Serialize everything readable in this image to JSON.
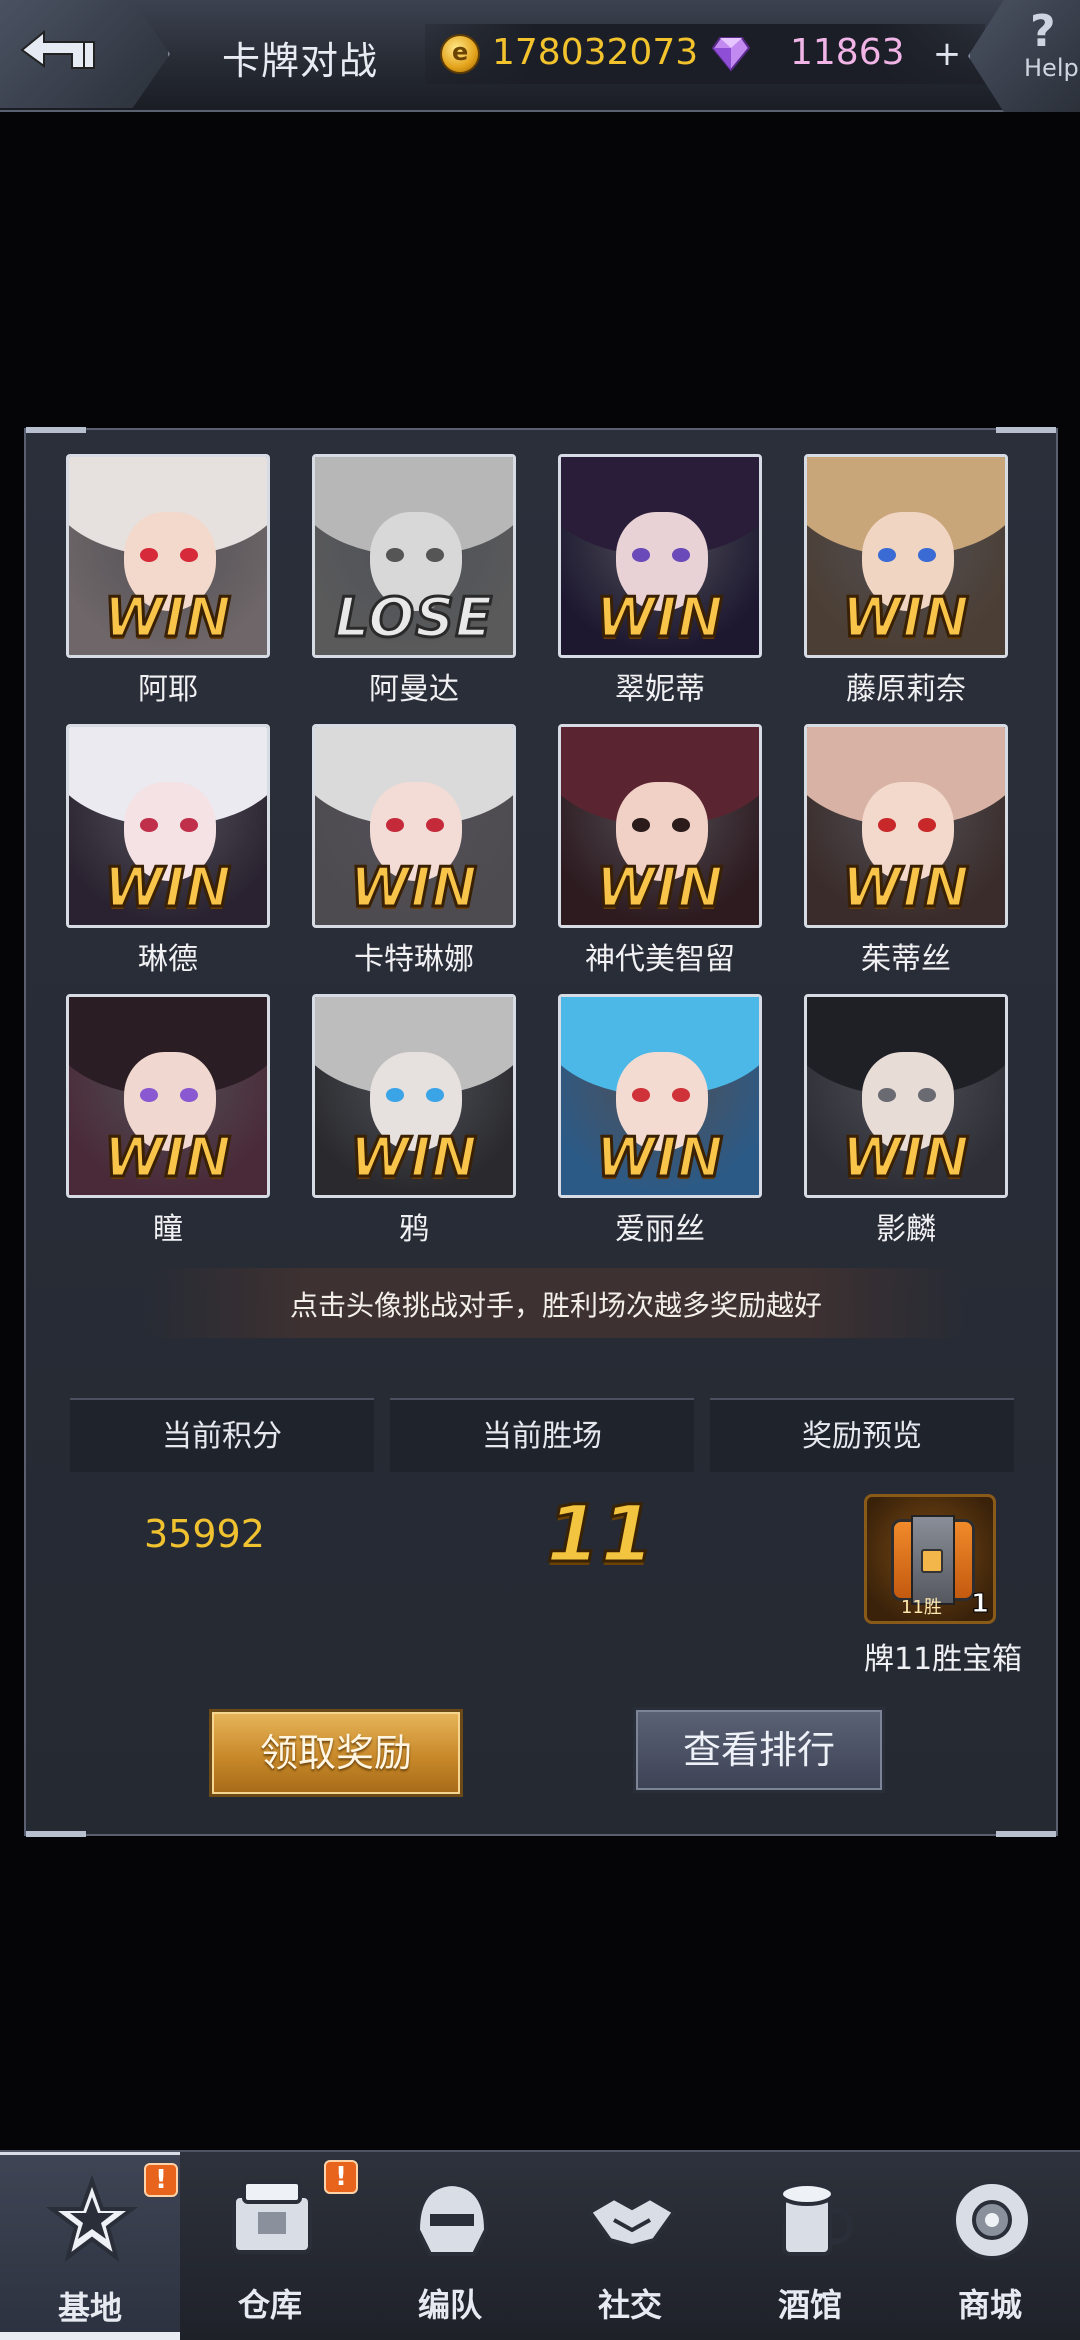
{
  "header": {
    "title": "卡牌对战",
    "gold": "178032073",
    "gems": "11863",
    "plus_label": "+",
    "help_label": "Help",
    "help_glyph": "?"
  },
  "opponents": [
    {
      "name": "阿耶",
      "result": "WIN",
      "hair": "#e6e1de",
      "skin": "#f3d9cc",
      "eye": "#d62a3a",
      "bg": "#6e6668"
    },
    {
      "name": "阿曼达",
      "result": "LOSE",
      "hair": "#b7b7b7",
      "skin": "#d8d8d8",
      "eye": "#555555",
      "bg": "#5a5a5a"
    },
    {
      "name": "翠妮蒂",
      "result": "WIN",
      "hair": "#2a1d3a",
      "skin": "#e8d2d6",
      "eye": "#6a4ab8",
      "bg": "#1d1830"
    },
    {
      "name": "藤原莉奈",
      "result": "WIN",
      "hair": "#c9a57a",
      "skin": "#f1d5c3",
      "eye": "#3a6bd4",
      "bg": "#4b3e34"
    },
    {
      "name": "琳德",
      "result": "WIN",
      "hair": "#eaeaf0",
      "skin": "#f5e2e4",
      "eye": "#c0304a",
      "bg": "#2a2230"
    },
    {
      "name": "卡特琳娜",
      "result": "WIN",
      "hair": "#dadada",
      "skin": "#f3dcd6",
      "eye": "#c52a3a",
      "bg": "#4e4b50"
    },
    {
      "name": "神代美智留",
      "result": "WIN",
      "hair": "#5a2430",
      "skin": "#f1d0c5",
      "eye": "#2b1b1b",
      "bg": "#2d1b20"
    },
    {
      "name": "茱蒂丝",
      "result": "WIN",
      "hair": "#d8b2a4",
      "skin": "#f3d8cc",
      "eye": "#c8282a",
      "bg": "#3a2c2a"
    },
    {
      "name": "瞳",
      "result": "WIN",
      "hair": "#2b1d24",
      "skin": "#f0d7cf",
      "eye": "#8a58d0",
      "bg": "#4a2a38"
    },
    {
      "name": "鸦",
      "result": "WIN",
      "hair": "#bdbdbd",
      "skin": "#e6e0de",
      "eye": "#3aa4e6",
      "bg": "#2a2a2e"
    },
    {
      "name": "爱丽丝",
      "result": "WIN",
      "hair": "#4cb8e8",
      "skin": "#f3dbd2",
      "eye": "#d0323a",
      "bg": "#2c5a86"
    },
    {
      "name": "影麟",
      "result": "WIN",
      "hair": "#1f2026",
      "skin": "#e8dcd6",
      "eye": "#6a6a72",
      "bg": "#2e2e36"
    }
  ],
  "hint": "点击头像挑战对手，胜利场次越多奖励越好",
  "stats": {
    "score_label": "当前积分",
    "wins_label": "当前胜场",
    "reward_label": "奖励预览",
    "score_value": "35992",
    "wins_value": "11"
  },
  "reward": {
    "tag": "11胜",
    "count": "1",
    "name": "牌11胜宝箱"
  },
  "buttons": {
    "claim": "领取奖励",
    "ranking": "查看排行"
  },
  "nav": [
    {
      "label": "基地",
      "icon": "base-star-icon",
      "badge": "!"
    },
    {
      "label": "仓库",
      "icon": "warehouse-crate-icon",
      "badge": "!"
    },
    {
      "label": "编队",
      "icon": "squad-helmet-icon",
      "badge": ""
    },
    {
      "label": "社交",
      "icon": "handshake-icon",
      "badge": ""
    },
    {
      "label": "酒馆",
      "icon": "tavern-mug-icon",
      "badge": ""
    },
    {
      "label": "商城",
      "icon": "shop-robot-icon",
      "badge": ""
    }
  ],
  "colors": {
    "accent_gold": "#f3c43f",
    "gem_pink": "#f0b4e6",
    "panel_bg": "#2b2f3a",
    "badge_orange": "#e8641c"
  }
}
